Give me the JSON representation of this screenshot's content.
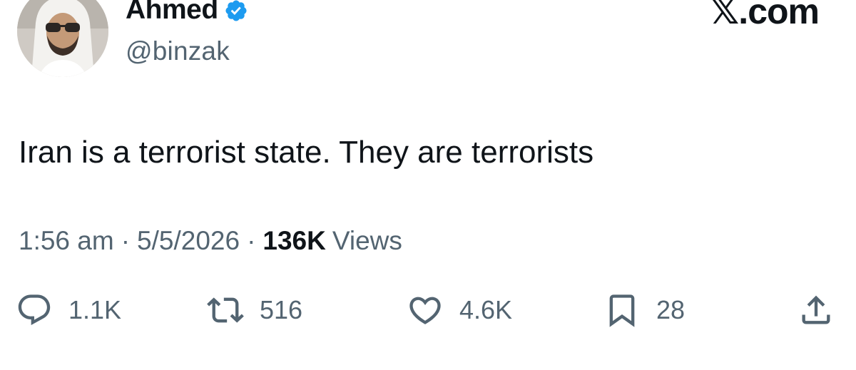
{
  "author": {
    "name": "Ahmed",
    "handle": "@binzak",
    "verified": true,
    "avatar_icon": "profile-photo"
  },
  "site": {
    "logo_mark": "𝕏",
    "logo_suffix": ".com"
  },
  "tweet": {
    "text": "Iran is a terrorist state. They are terrorists"
  },
  "meta": {
    "time": "1:56 am",
    "separator": "·",
    "date": "5/5/2026",
    "views_count": "136K",
    "views_label": "Views"
  },
  "actions": {
    "reply": {
      "icon": "reply-icon",
      "count": "1.1K"
    },
    "retweet": {
      "icon": "retweet-icon",
      "count": "516"
    },
    "like": {
      "icon": "heart-icon",
      "count": "4.6K"
    },
    "bookmark": {
      "icon": "bookmark-icon",
      "count": "28"
    },
    "share": {
      "icon": "share-icon"
    }
  },
  "colors": {
    "text_primary": "#0f1419",
    "text_secondary": "#536471",
    "verified_blue": "#1d9bf0"
  }
}
